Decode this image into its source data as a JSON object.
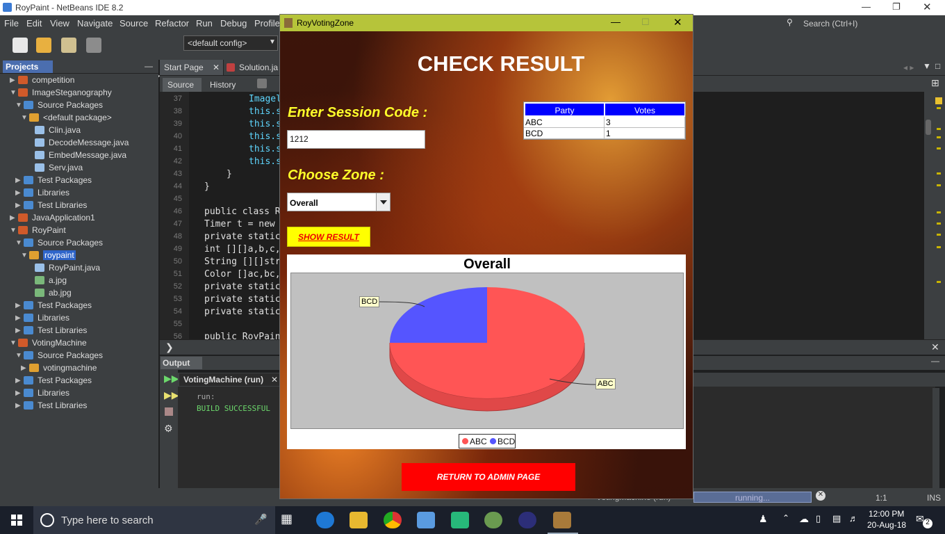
{
  "ide": {
    "title": "RoyPaint - NetBeans IDE 8.2",
    "menu": [
      "File",
      "Edit",
      "View",
      "Navigate",
      "Source",
      "Refactor",
      "Run",
      "Debug",
      "Profile"
    ],
    "search_placeholder": "Search (Ctrl+I)",
    "config": "<default config>",
    "projects_tab": "Projects",
    "tree": [
      {
        "label": "competition",
        "type": "proj"
      },
      {
        "label": "ImageSteganography",
        "type": "proj"
      },
      {
        "label": "Source Packages",
        "type": "pkg"
      },
      {
        "label": "<default package>",
        "type": "dpkg"
      },
      {
        "label": "Clin.java",
        "type": "java"
      },
      {
        "label": "DecodeMessage.java",
        "type": "java"
      },
      {
        "label": "EmbedMessage.java",
        "type": "java"
      },
      {
        "label": "Serv.java",
        "type": "java"
      },
      {
        "label": "Test Packages",
        "type": "pkg"
      },
      {
        "label": "Libraries",
        "type": "pkg"
      },
      {
        "label": "Test Libraries",
        "type": "pkg"
      },
      {
        "label": "JavaApplication1",
        "type": "proj"
      },
      {
        "label": "RoyPaint",
        "type": "proj"
      },
      {
        "label": "Source Packages",
        "type": "pkg"
      },
      {
        "label": "roypaint",
        "type": "dpkg"
      },
      {
        "label": "RoyPaint.java",
        "type": "java"
      },
      {
        "label": "a.jpg",
        "type": "img"
      },
      {
        "label": "ab.jpg",
        "type": "img"
      },
      {
        "label": "Test Packages",
        "type": "pkg"
      },
      {
        "label": "Libraries",
        "type": "pkg"
      },
      {
        "label": "Test Libraries",
        "type": "pkg"
      },
      {
        "label": "VotingMachine",
        "type": "proj"
      },
      {
        "label": "Source Packages",
        "type": "pkg"
      },
      {
        "label": "votingmachine",
        "type": "dpkg"
      },
      {
        "label": "Test Packages",
        "type": "pkg"
      },
      {
        "label": "Libraries",
        "type": "pkg"
      },
      {
        "label": "Test Libraries",
        "type": "pkg"
      }
    ],
    "editor_tabs": [
      "Start Page",
      "Solution.ja"
    ],
    "editor_views": [
      "Source",
      "History"
    ],
    "line_numbers": [
      "37",
      "38",
      "39",
      "40",
      "41",
      "42",
      "43",
      "44",
      "45",
      "46",
      "47",
      "48",
      "49",
      "50",
      "51",
      "52",
      "53",
      "54",
      "55",
      "56"
    ],
    "code_lines": [
      "Imagel",
      "this.s",
      "this.s",
      "this.s",
      "this.s",
      "this.s",
      "}",
      "}",
      "",
      "public class R",
      "Timer t = new",
      "private static",
      "int [][]a,b,c,",
      "String [][]str",
      "Color []ac,bc,",
      "private static",
      "private static",
      "private static",
      "",
      "public RoyPain"
    ],
    "output_tab": "Output",
    "run_tab": "VotingMachine (run)",
    "output_lines": [
      "run:",
      "BUILD SUCCESSFUL"
    ],
    "status_running": "running...",
    "status_task": "VotingMachine (run)",
    "status_pos": "1:1",
    "status_mode": "INS"
  },
  "dialog": {
    "title": "RoyVotingZone",
    "heading": "CHECK RESULT",
    "session_label": "Enter Session Code :",
    "session_value": "1212",
    "zone_label": "Choose Zone :",
    "zone_value": "Overall",
    "show_button": "SHOW RESULT",
    "table": {
      "headers": [
        "Party",
        "Votes"
      ],
      "rows": [
        [
          "ABC",
          "3"
        ],
        [
          "BCD",
          "1"
        ]
      ]
    },
    "return_button": "RETURN TO ADMIN PAGE"
  },
  "chart_data": {
    "type": "pie",
    "title": "Overall",
    "categories": [
      "ABC",
      "BCD"
    ],
    "values": [
      3,
      1
    ],
    "colors": [
      "#ff5555",
      "#5555ff"
    ],
    "legend": "bottom",
    "slice_labels": [
      "ABC",
      "BCD"
    ]
  },
  "taskbar": {
    "search_placeholder": "Type here to search",
    "time": "12:00 PM",
    "date": "20-Aug-18",
    "notification_count": "2"
  }
}
